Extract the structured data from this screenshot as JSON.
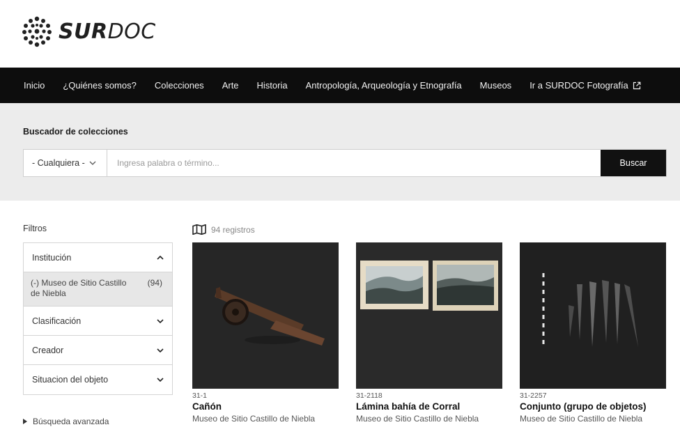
{
  "brand": {
    "name_bold": "SUR",
    "name_light": "DOC"
  },
  "nav": {
    "items": [
      "Inicio",
      "¿Quiénes somos?",
      "Colecciones",
      "Arte",
      "Historia",
      "Antropología, Arqueología y Etnografía",
      "Museos",
      "Ir a SURDOC Fotografía"
    ]
  },
  "search": {
    "title": "Buscador de colecciones",
    "select_value": "- Cualquiera -",
    "placeholder": "Ingresa palabra o término...",
    "button": "Buscar"
  },
  "filters": {
    "title": "Filtros",
    "institucion": "Institución",
    "selected_item": "(-) Museo de Sitio Castillo de Niebla",
    "selected_count": "(94)",
    "clasificacion": "Clasificación",
    "creador": "Creador",
    "situacion": "Situacion del objeto",
    "advanced": "Búsqueda avanzada"
  },
  "results": {
    "count_label": "94 registros",
    "cards": [
      {
        "code": "31-1",
        "title": "Cañón",
        "institution": "Museo de Sitio Castillo de Niebla"
      },
      {
        "code": "31-2118",
        "title": "Lámina bahía de Corral",
        "institution": "Museo de Sitio Castillo de Niebla"
      },
      {
        "code": "31-2257",
        "title": "Conjunto (grupo de objetos)",
        "institution": "Museo de Sitio Castillo de Niebla"
      }
    ]
  }
}
